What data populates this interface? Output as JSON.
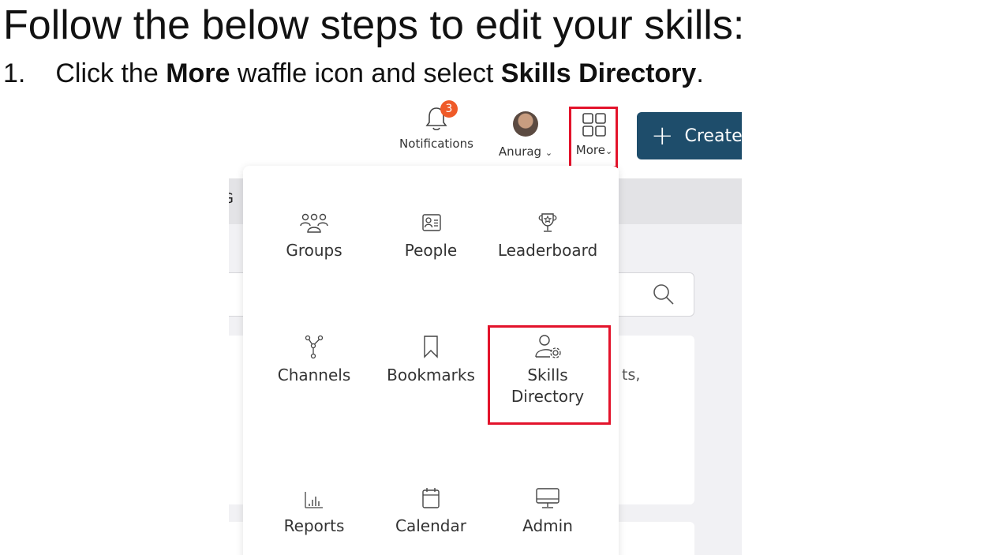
{
  "document": {
    "heading": "Follow the below steps to edit your skills:",
    "step_number": "1.",
    "step_text": {
      "part1": "Click the ",
      "bold1": "More",
      "part2": " waffle icon and select ",
      "bold2": "Skills Directory",
      "part3": "."
    }
  },
  "header": {
    "notifications": {
      "label": "Notifications",
      "badge_count": "3",
      "icon": "bell-icon"
    },
    "user": {
      "label": "Anurag",
      "icon": "avatar"
    },
    "more": {
      "label": "More",
      "icon": "waffle-icon"
    },
    "create_button": {
      "label": "Create",
      "icon": "plus-icon"
    }
  },
  "background": {
    "tab_fragment": "G",
    "card_fragment": "ts,"
  },
  "more_menu": {
    "items": [
      {
        "label": "Groups",
        "icon": "groups-icon"
      },
      {
        "label": "People",
        "icon": "people-icon"
      },
      {
        "label": "Leaderboard",
        "icon": "trophy-icon"
      },
      {
        "label": "Channels",
        "icon": "channels-icon"
      },
      {
        "label": "Bookmarks",
        "icon": "bookmark-icon"
      },
      {
        "label_line1": "Skills",
        "label_line2": "Directory",
        "icon": "skills-directory-icon"
      },
      {
        "label": "Reports",
        "icon": "reports-icon"
      },
      {
        "label": "Calendar",
        "icon": "calendar-icon"
      },
      {
        "label": "Admin",
        "icon": "admin-monitor-icon"
      }
    ]
  },
  "colors": {
    "highlight": "#e3132b",
    "create_button": "#1e4d6b",
    "badge": "#ef5a28"
  }
}
